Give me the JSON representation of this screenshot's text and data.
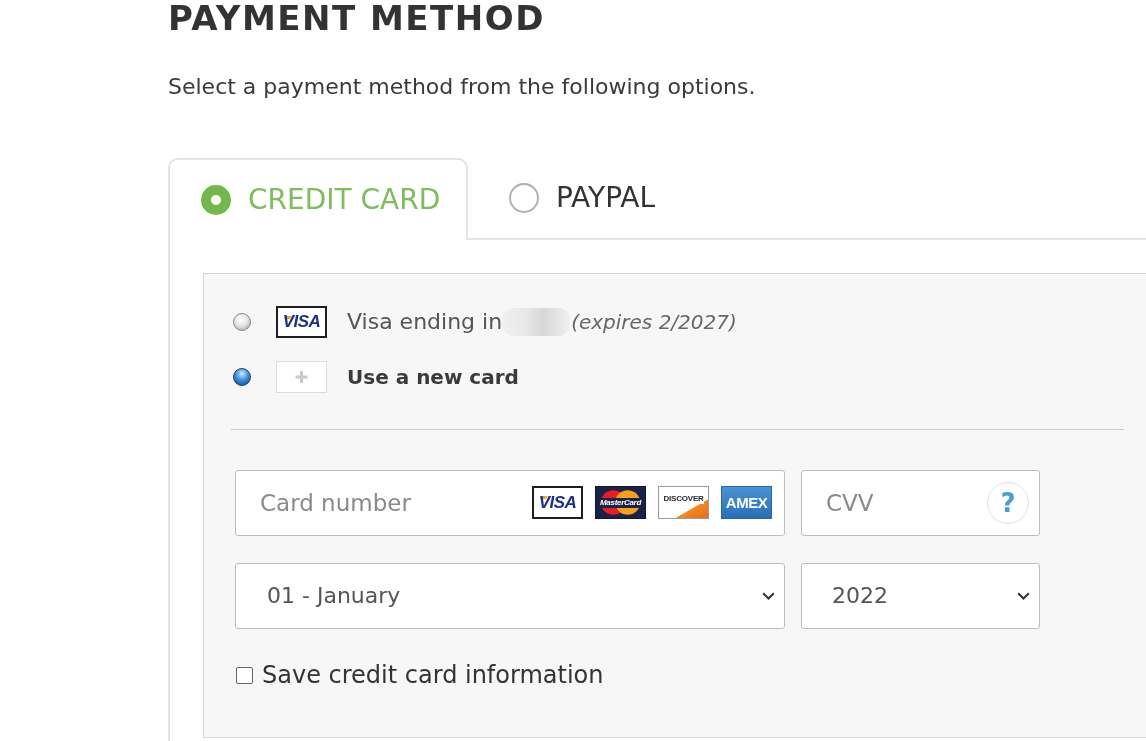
{
  "title": "PAYMENT METHOD",
  "subtitle": "Select a payment method from the following options.",
  "tabs": [
    {
      "label": "CREDIT CARD",
      "selected": true
    },
    {
      "label": "PAYPAL",
      "selected": false
    }
  ],
  "payment_options": [
    {
      "kind": "saved",
      "brand": {
        "kind": "visa",
        "label": "VISA"
      },
      "label": "Visa ending in",
      "masked": true,
      "note": "(expires 2/2027)",
      "selected": false
    },
    {
      "kind": "new",
      "label": "Use a new card",
      "selected": true
    }
  ],
  "card_form": {
    "card_number": {
      "placeholder": "Card number",
      "brands": [
        {
          "kind": "visa",
          "label": "VISA"
        },
        {
          "kind": "mastercard",
          "label": "MasterCard"
        },
        {
          "kind": "discover",
          "label": "DISCOVER"
        },
        {
          "kind": "amex",
          "label": "AMEX"
        }
      ]
    },
    "cvv": {
      "placeholder": "CVV",
      "help": "?"
    },
    "expiry_month": {
      "value": "01 - January"
    },
    "expiry_year": {
      "value": "2022"
    },
    "save_card": {
      "label": "Save credit card information",
      "checked": false
    }
  }
}
